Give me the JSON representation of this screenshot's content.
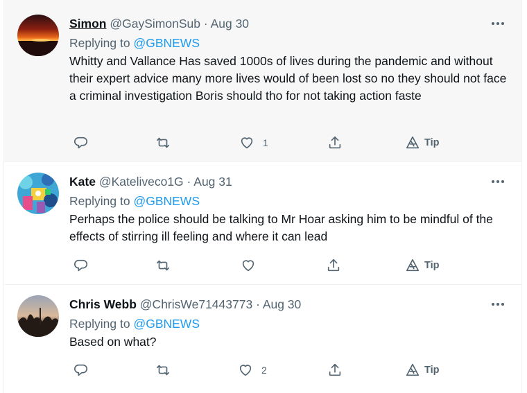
{
  "tweets": [
    {
      "name": "Simon",
      "handle": "@GaySimonSub",
      "separator": "·",
      "date": "Aug 30",
      "replying_prefix": "Replying to",
      "replying_to": "@GBNEWS",
      "text": "Whitty and Vallance Has saved 1000s of lives during the pandemic and without their expert advice many more lives would of been lost so no they should not face a criminal investigation Boris should tho for not taking action faste",
      "like_count": "1",
      "tip_label": "Tip",
      "avatar": "sunset-photo"
    },
    {
      "name": "Kate",
      "handle": "@Kateliveco1G",
      "separator": "·",
      "date": "Aug 31",
      "replying_prefix": "Replying to",
      "replying_to": "@GBNEWS",
      "text": "Perhaps the police should be talking to Mr Hoar asking him to be mindful of the effects of stirring ill feeling and where it can lead",
      "like_count": "",
      "tip_label": "Tip",
      "avatar": "colorful-artwork"
    },
    {
      "name": "Chris Webb",
      "handle": "@ChrisWe71443773",
      "separator": "·",
      "date": "Aug 30",
      "replying_prefix": "Replying to",
      "replying_to": "@GBNEWS",
      "text": "Based on what?",
      "like_count": "2",
      "tip_label": "Tip",
      "avatar": "dusk-trees-photo"
    }
  ],
  "colors": {
    "accent": "#1d9bf0",
    "secondary_text": "#536471",
    "primary_text": "#0f1419",
    "hover_background": "#f7f7f7",
    "divider": "#eff3f4"
  }
}
